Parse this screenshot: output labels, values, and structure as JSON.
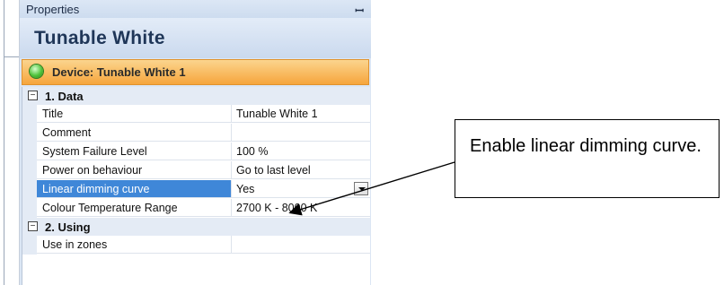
{
  "panel": {
    "title": "Properties",
    "pin_glyph": "ꟷ",
    "heading": "Tunable White",
    "device_label": "Device: Tunable White 1",
    "device_status_color": "#4ec23a"
  },
  "categories": [
    {
      "toggle": "−",
      "label": "1. Data",
      "rows": [
        {
          "name": "Title",
          "value": "Tunable White 1"
        },
        {
          "name": "Comment",
          "value": ""
        },
        {
          "name": "System Failure Level",
          "value": "100 %"
        },
        {
          "name": "Power on behaviour",
          "value": "Go to last level"
        },
        {
          "name": "Linear dimming curve",
          "value": "Yes",
          "selected": true
        },
        {
          "name": "Colour Temperature Range",
          "value": "2700 K - 8000 K"
        }
      ]
    },
    {
      "toggle": "−",
      "label": "2. Using",
      "rows": [
        {
          "name": "Use in zones",
          "value": ""
        }
      ]
    }
  ],
  "callout": {
    "text": "Enable linear dimming curve."
  },
  "colors": {
    "selection": "#3f87d8",
    "device_bar": "#f6a53c",
    "panel_bg": "#dbe6f4"
  }
}
